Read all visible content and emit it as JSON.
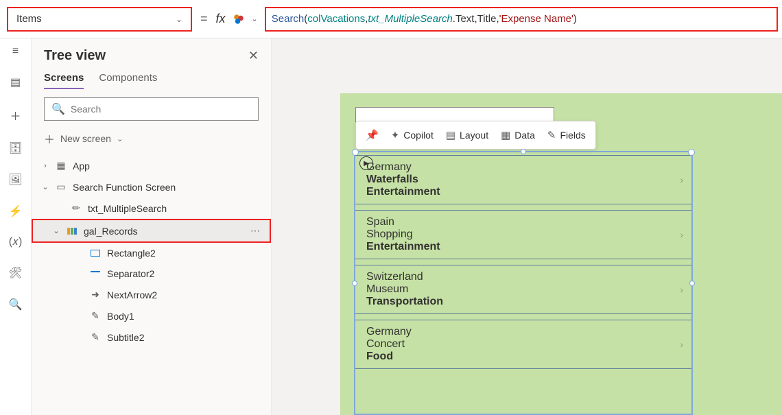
{
  "topbar": {
    "property": "Items",
    "eq": "=",
    "fx_label": "fx",
    "formula": {
      "func": "Search",
      "p_open": "(",
      "coll": "colVacations",
      "c1": ",",
      "var": "txt_MultipleSearch",
      "dot": ".",
      "prop": "Text",
      "c2": ",",
      "field": "Title",
      "c3": ",",
      "str": "'Expense Name'",
      "p_close": ")"
    }
  },
  "tree": {
    "title": "Tree view",
    "tabs": {
      "screens": "Screens",
      "components": "Components"
    },
    "search_placeholder": "Search",
    "new_screen": "New screen",
    "nodes": {
      "app": "App",
      "screen": "Search Function Screen",
      "txt": "txt_MultipleSearch",
      "gal": "gal_Records",
      "rect": "Rectangle2",
      "sep": "Separator2",
      "next": "NextArrow2",
      "body": "Body1",
      "sub": "Subtitle2"
    }
  },
  "float_toolbar": {
    "copilot": "Copilot",
    "layout": "Layout",
    "data": "Data",
    "fields": "Fields"
  },
  "gallery": [
    {
      "title": "Germany",
      "sub": "Waterfalls",
      "body": "Entertainment"
    },
    {
      "title": "Spain",
      "sub": "Shopping",
      "body": "Entertainment"
    },
    {
      "title": "Switzerland",
      "sub": "Museum",
      "body": "Transportation"
    },
    {
      "title": "Germany",
      "sub": "Concert",
      "body": "Food"
    }
  ]
}
